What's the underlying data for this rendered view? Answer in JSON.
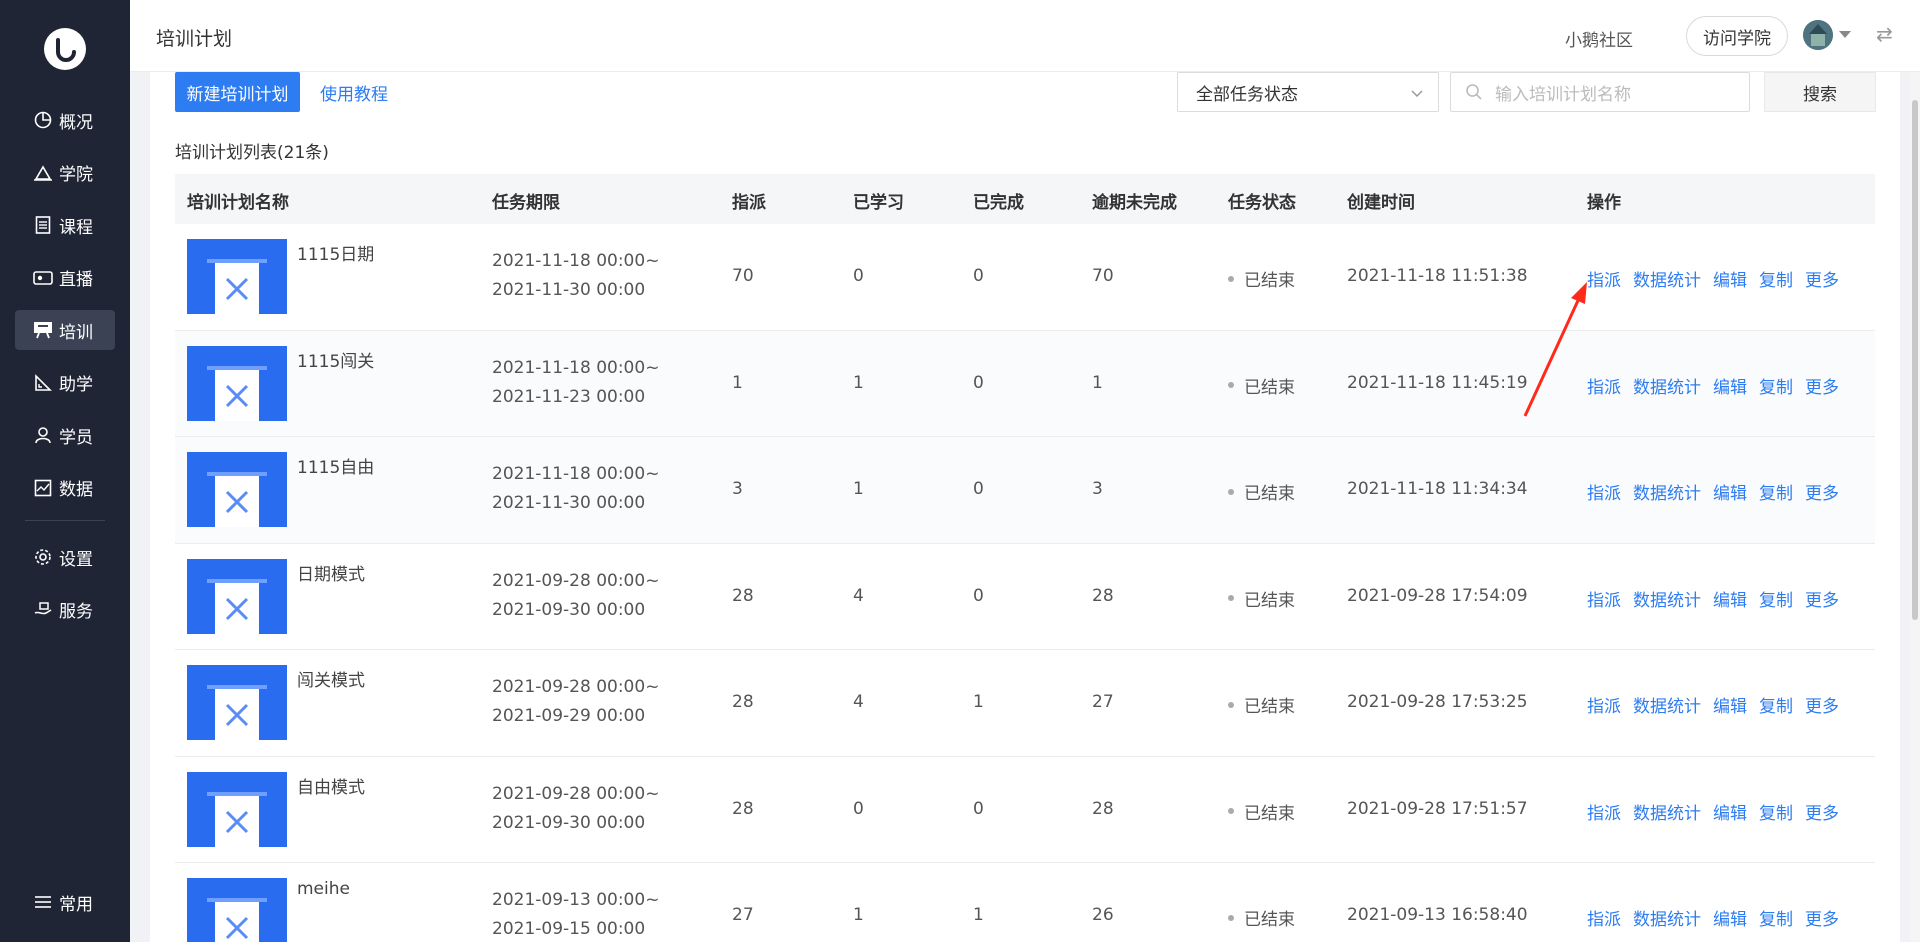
{
  "sidebar": {
    "items": [
      {
        "label": "概况",
        "icon": "pie-chart-icon"
      },
      {
        "label": "学院",
        "icon": "academy-icon"
      },
      {
        "label": "课程",
        "icon": "document-icon"
      },
      {
        "label": "直播",
        "icon": "live-icon"
      },
      {
        "label": "培训",
        "icon": "training-icon",
        "active": true
      },
      {
        "label": "助学",
        "icon": "assist-icon"
      },
      {
        "label": "学员",
        "icon": "user-icon"
      },
      {
        "label": "数据",
        "icon": "data-icon"
      }
    ],
    "settings": [
      {
        "label": "设置",
        "icon": "gear-icon"
      },
      {
        "label": "服务",
        "icon": "service-icon"
      }
    ],
    "bottom": {
      "label": "常用",
      "icon": "list-icon"
    }
  },
  "header": {
    "title": "培训计划",
    "community": "小鹅社区",
    "visit_label": "访问学院"
  },
  "toolbar": {
    "new_label": "新建培训计划",
    "tutorial_label": "使用教程",
    "status_select": "全部任务状态",
    "search_placeholder": "输入培训计划名称",
    "search_label": "搜索"
  },
  "list": {
    "count_label": "培训计划列表(21条)",
    "columns": [
      "培训计划名称",
      "任务期限",
      "指派",
      "已学习",
      "已完成",
      "逾期未完成",
      "任务状态",
      "创建时间",
      "操作"
    ],
    "ops": [
      "指派",
      "数据统计",
      "编辑",
      "复制",
      "更多"
    ],
    "rows": [
      {
        "name": "1115日期",
        "start": "2021-11-18 00:00~",
        "end": "2021-11-30 00:00",
        "assigned": "70",
        "learned": "0",
        "done": "0",
        "overdue": "70",
        "status": "已结束",
        "created": "2021-11-18 11:51:38"
      },
      {
        "name": "1115闯关",
        "start": "2021-11-18 00:00~",
        "end": "2021-11-23 00:00",
        "assigned": "1",
        "learned": "1",
        "done": "0",
        "overdue": "1",
        "status": "已结束",
        "created": "2021-11-18 11:45:19"
      },
      {
        "name": "1115自由",
        "start": "2021-11-18 00:00~",
        "end": "2021-11-30 00:00",
        "assigned": "3",
        "learned": "1",
        "done": "0",
        "overdue": "3",
        "status": "已结束",
        "created": "2021-11-18 11:34:34"
      },
      {
        "name": "日期模式",
        "start": "2021-09-28 00:00~",
        "end": "2021-09-30 00:00",
        "assigned": "28",
        "learned": "4",
        "done": "0",
        "overdue": "28",
        "status": "已结束",
        "created": "2021-09-28 17:54:09"
      },
      {
        "name": "闯关模式",
        "start": "2021-09-28 00:00~",
        "end": "2021-09-29 00:00",
        "assigned": "28",
        "learned": "4",
        "done": "1",
        "overdue": "27",
        "status": "已结束",
        "created": "2021-09-28 17:53:25"
      },
      {
        "name": "自由模式",
        "start": "2021-09-28 00:00~",
        "end": "2021-09-30 00:00",
        "assigned": "28",
        "learned": "0",
        "done": "0",
        "overdue": "28",
        "status": "已结束",
        "created": "2021-09-28 17:51:57"
      },
      {
        "name": "meihe",
        "start": "2021-09-13 00:00~",
        "end": "2021-09-15 00:00",
        "assigned": "27",
        "learned": "1",
        "done": "1",
        "overdue": "26",
        "status": "已结束",
        "created": "2021-09-13 16:58:40"
      }
    ]
  },
  "colors": {
    "accent": "#2d7cf2",
    "sidebar_bg": "#1f2535",
    "arrow": "#ff2a1a"
  }
}
